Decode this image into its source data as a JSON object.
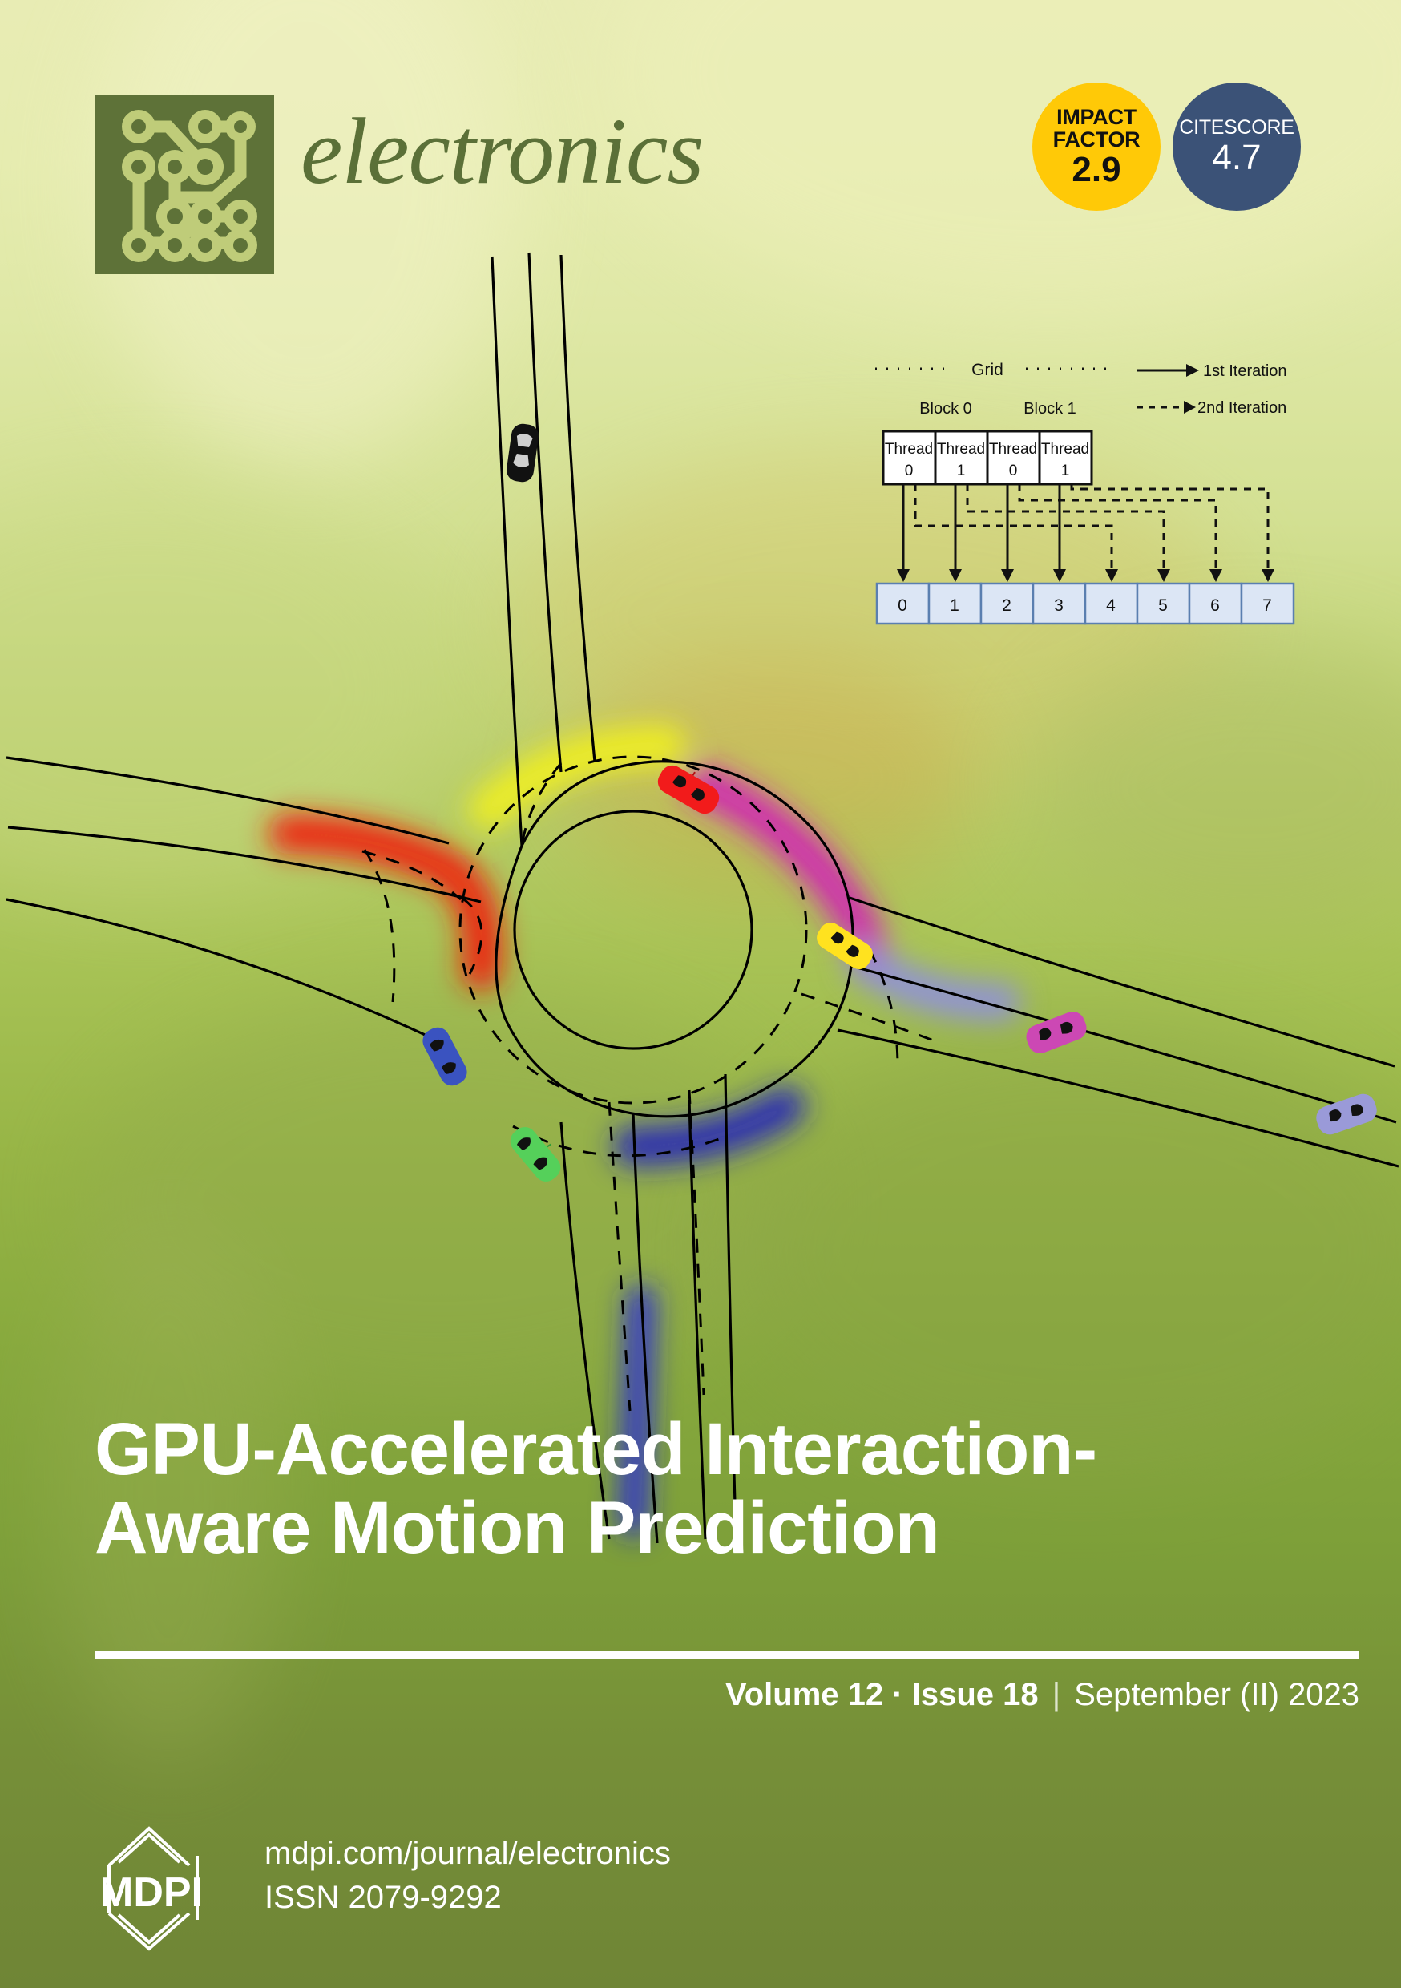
{
  "journal": {
    "name": "electronics",
    "logo_icon": "circuit-board-icon"
  },
  "badges": {
    "impact_factor": {
      "label_line1": "IMPACT",
      "label_line2": "FACTOR",
      "value": "2.9",
      "color": "#ffc907"
    },
    "citescore": {
      "label": "CITESCORE",
      "value": "4.7",
      "color": "#3b5277"
    }
  },
  "cover": {
    "title_line1": "GPU-Accelerated Interaction-",
    "title_line2": "Aware Motion Prediction",
    "volume": "Volume 12",
    "dot": "·",
    "issue": "Issue 18",
    "separator": "|",
    "date": "September (II) 2023"
  },
  "footer": {
    "publisher": "MDPI",
    "url": "mdpi.com/journal/electronics",
    "issn": "ISSN 2079-9292"
  },
  "gpu_diagram": {
    "grid_label": "Grid",
    "blocks": [
      {
        "label": "Block 0",
        "threads": [
          {
            "name": "Thread",
            "index": "0"
          },
          {
            "name": "Thread",
            "index": "1"
          }
        ]
      },
      {
        "label": "Block 1",
        "threads": [
          {
            "name": "Thread",
            "index": "0"
          },
          {
            "name": "Thread",
            "index": "1"
          }
        ]
      }
    ],
    "memory_cells": [
      "0",
      "1",
      "2",
      "3",
      "4",
      "5",
      "6",
      "7"
    ],
    "legend": [
      {
        "label": "1st Iteration",
        "style": "solid"
      },
      {
        "label": "2nd Iteration",
        "style": "dashed"
      }
    ],
    "cell_fill": "#dce6f5",
    "cell_stroke": "#5a7fb0"
  },
  "artwork": {
    "description": "roundabout-motion-prediction-illustration",
    "vehicles": [
      {
        "name": "vehicle-black",
        "color": "#111111"
      },
      {
        "name": "vehicle-red",
        "color": "#f21b1b"
      },
      {
        "name": "vehicle-yellow",
        "color": "#ffe21f"
      },
      {
        "name": "vehicle-blue",
        "color": "#3a53c0"
      },
      {
        "name": "vehicle-green",
        "color": "#55d05a"
      },
      {
        "name": "vehicle-magenta",
        "color": "#cc48b4"
      },
      {
        "name": "vehicle-purple",
        "color": "#9a9ad8"
      }
    ],
    "trajectory_heatmaps": [
      {
        "name": "heat-red",
        "color": "#ee2211"
      },
      {
        "name": "heat-yellow",
        "color": "#eeee22"
      },
      {
        "name": "heat-magenta",
        "color": "#d022b4"
      },
      {
        "name": "heat-purple",
        "color": "#8f8fe0"
      },
      {
        "name": "heat-navy",
        "color": "#2222bb"
      }
    ]
  }
}
